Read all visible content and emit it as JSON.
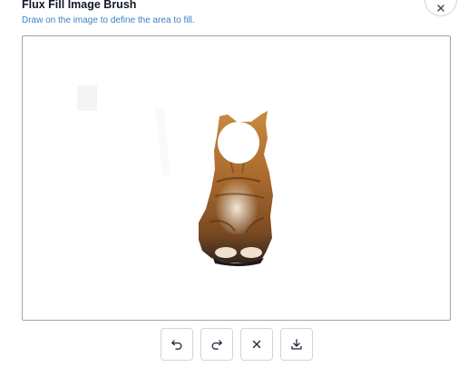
{
  "dialog": {
    "title": "Flux Fill Image Brush",
    "subtitle": "Draw on the image to define the area to fill."
  },
  "close": {
    "icon": "close-icon"
  },
  "canvas": {
    "image": "cat-photo",
    "mask": "white brush strokes"
  },
  "toolbar": {
    "buttons": [
      {
        "name": "undo",
        "icon": "undo-icon"
      },
      {
        "name": "redo",
        "icon": "redo-icon"
      },
      {
        "name": "clear",
        "icon": "close-icon"
      },
      {
        "name": "download",
        "icon": "download-icon"
      }
    ]
  },
  "colors": {
    "title": "#111827",
    "subtitle": "#3b82c4",
    "border": "#9ca3af"
  }
}
